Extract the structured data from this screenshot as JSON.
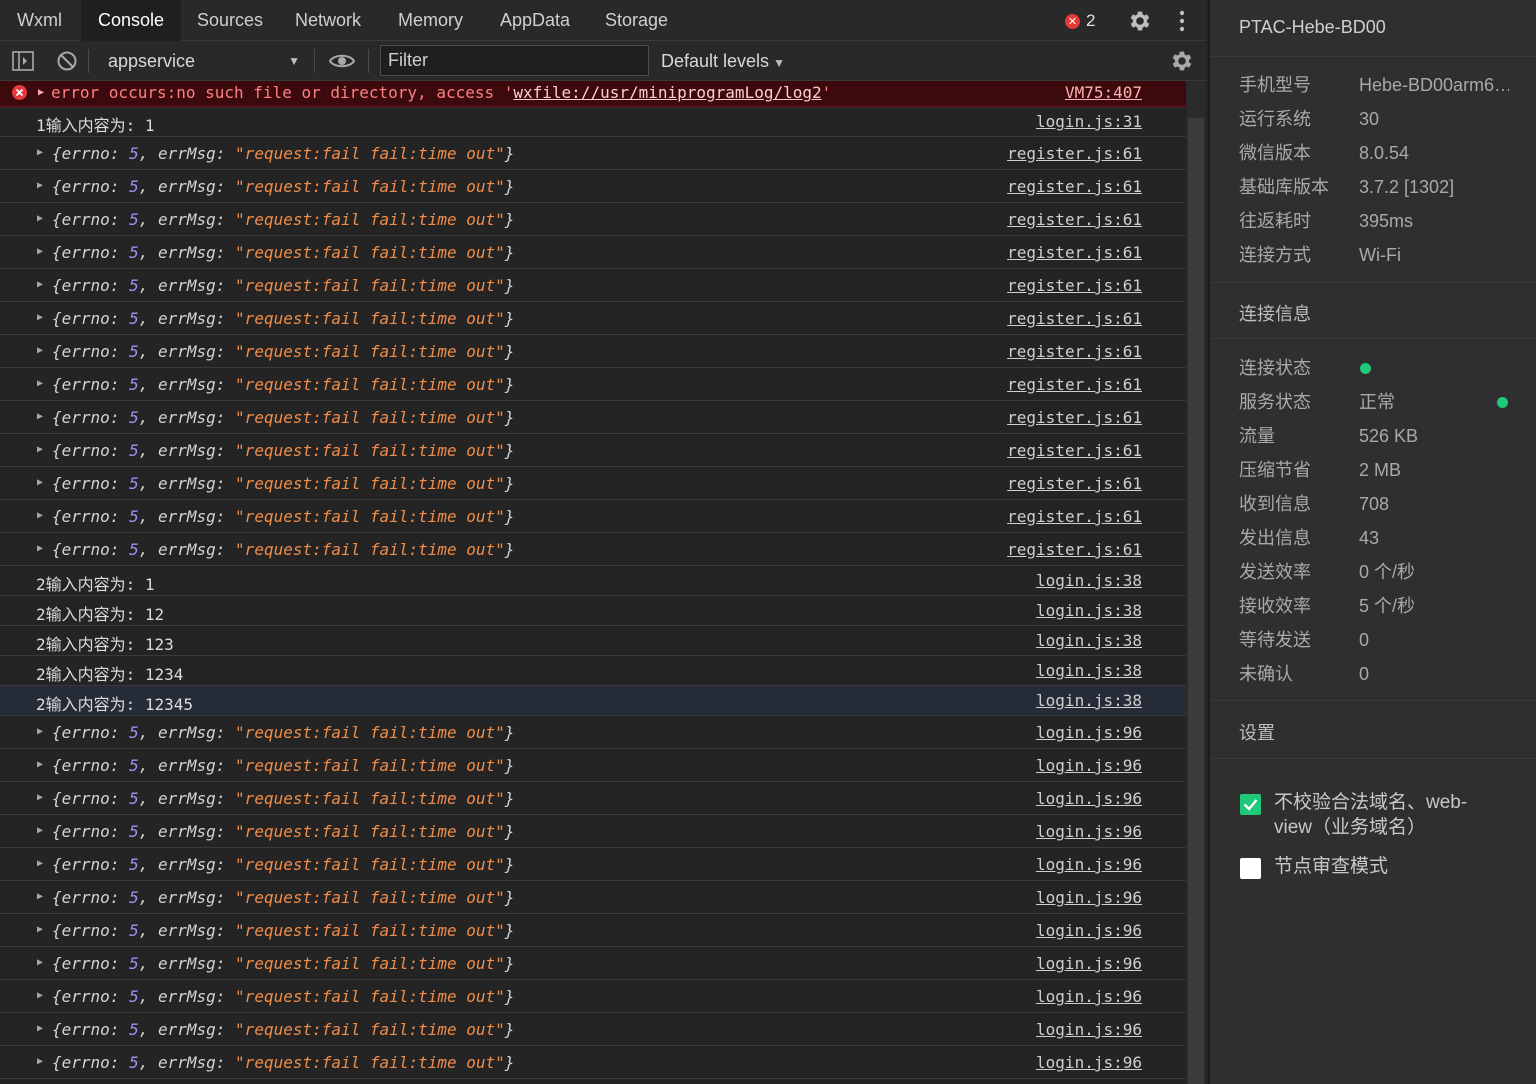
{
  "tabs": [
    {
      "label": "Wxml",
      "active": false
    },
    {
      "label": "Console",
      "active": true
    },
    {
      "label": "Sources",
      "active": false
    },
    {
      "label": "Network",
      "active": false
    },
    {
      "label": "Memory",
      "active": false
    },
    {
      "label": "AppData",
      "active": false
    },
    {
      "label": "Storage",
      "active": false
    }
  ],
  "error_count": "2",
  "toolbar": {
    "context": "appservice",
    "filter_placeholder": "Filter",
    "levels": "Default levels"
  },
  "console": {
    "error": {
      "prefix": "error occurs:no such file or directory, access '",
      "link": "wxfile://usr/miniprogramLog/log2",
      "suffix": "'",
      "source": "VM75:407"
    },
    "rows": [
      {
        "kind": "text",
        "text": "1输入内容为: 1",
        "source": "login.js:31"
      },
      {
        "kind": "obj",
        "errno": "5",
        "errMsg": "\"request:fail fail:time out\"",
        "source": "register.js:61"
      },
      {
        "kind": "obj",
        "errno": "5",
        "errMsg": "\"request:fail fail:time out\"",
        "source": "register.js:61"
      },
      {
        "kind": "obj",
        "errno": "5",
        "errMsg": "\"request:fail fail:time out\"",
        "source": "register.js:61"
      },
      {
        "kind": "obj",
        "errno": "5",
        "errMsg": "\"request:fail fail:time out\"",
        "source": "register.js:61"
      },
      {
        "kind": "obj",
        "errno": "5",
        "errMsg": "\"request:fail fail:time out\"",
        "source": "register.js:61"
      },
      {
        "kind": "obj",
        "errno": "5",
        "errMsg": "\"request:fail fail:time out\"",
        "source": "register.js:61"
      },
      {
        "kind": "obj",
        "errno": "5",
        "errMsg": "\"request:fail fail:time out\"",
        "source": "register.js:61"
      },
      {
        "kind": "obj",
        "errno": "5",
        "errMsg": "\"request:fail fail:time out\"",
        "source": "register.js:61"
      },
      {
        "kind": "obj",
        "errno": "5",
        "errMsg": "\"request:fail fail:time out\"",
        "source": "register.js:61"
      },
      {
        "kind": "obj",
        "errno": "5",
        "errMsg": "\"request:fail fail:time out\"",
        "source": "register.js:61"
      },
      {
        "kind": "obj",
        "errno": "5",
        "errMsg": "\"request:fail fail:time out\"",
        "source": "register.js:61"
      },
      {
        "kind": "obj",
        "errno": "5",
        "errMsg": "\"request:fail fail:time out\"",
        "source": "register.js:61"
      },
      {
        "kind": "obj",
        "errno": "5",
        "errMsg": "\"request:fail fail:time out\"",
        "source": "register.js:61"
      },
      {
        "kind": "text",
        "text": "2输入内容为: 1",
        "source": "login.js:38"
      },
      {
        "kind": "text",
        "text": "2输入内容为: 12",
        "source": "login.js:38"
      },
      {
        "kind": "text",
        "text": "2输入内容为: 123",
        "source": "login.js:38"
      },
      {
        "kind": "text",
        "text": "2输入内容为: 1234",
        "source": "login.js:38"
      },
      {
        "kind": "text",
        "text": "2输入内容为: 12345",
        "source": "login.js:38",
        "highlight": true
      },
      {
        "kind": "obj",
        "errno": "5",
        "errMsg": "\"request:fail fail:time out\"",
        "source": "login.js:96"
      },
      {
        "kind": "obj",
        "errno": "5",
        "errMsg": "\"request:fail fail:time out\"",
        "source": "login.js:96"
      },
      {
        "kind": "obj",
        "errno": "5",
        "errMsg": "\"request:fail fail:time out\"",
        "source": "login.js:96"
      },
      {
        "kind": "obj",
        "errno": "5",
        "errMsg": "\"request:fail fail:time out\"",
        "source": "login.js:96"
      },
      {
        "kind": "obj",
        "errno": "5",
        "errMsg": "\"request:fail fail:time out\"",
        "source": "login.js:96"
      },
      {
        "kind": "obj",
        "errno": "5",
        "errMsg": "\"request:fail fail:time out\"",
        "source": "login.js:96"
      },
      {
        "kind": "obj",
        "errno": "5",
        "errMsg": "\"request:fail fail:time out\"",
        "source": "login.js:96"
      },
      {
        "kind": "obj",
        "errno": "5",
        "errMsg": "\"request:fail fail:time out\"",
        "source": "login.js:96"
      },
      {
        "kind": "obj",
        "errno": "5",
        "errMsg": "\"request:fail fail:time out\"",
        "source": "login.js:96"
      },
      {
        "kind": "obj",
        "errno": "5",
        "errMsg": "\"request:fail fail:time out\"",
        "source": "login.js:96"
      },
      {
        "kind": "obj",
        "errno": "5",
        "errMsg": "\"request:fail fail:time out\"",
        "source": "login.js:96"
      }
    ]
  },
  "device": {
    "name": "PTAC-Hebe-BD00",
    "info": [
      {
        "label": "手机型号",
        "value": "Hebe-BD00arm6…"
      },
      {
        "label": "运行系统",
        "value": "30"
      },
      {
        "label": "微信版本",
        "value": "8.0.54"
      },
      {
        "label": "基础库版本",
        "value": "3.7.2 [1302]"
      },
      {
        "label": "往返耗时",
        "value": "395ms"
      },
      {
        "label": "连接方式",
        "value": "Wi-Fi"
      }
    ],
    "connection_title": "连接信息",
    "connection": [
      {
        "label": "连接状态",
        "value": "",
        "dot": "inline"
      },
      {
        "label": "服务状态",
        "value": "正常",
        "dot": "right"
      },
      {
        "label": "流量",
        "value": "526 KB"
      },
      {
        "label": "压缩节省",
        "value": "2 MB"
      },
      {
        "label": "收到信息",
        "value": "708"
      },
      {
        "label": "发出信息",
        "value": "43"
      },
      {
        "label": "发送效率",
        "value": "0 个/秒"
      },
      {
        "label": "接收效率",
        "value": "5 个/秒"
      },
      {
        "label": "等待发送",
        "value": "0"
      },
      {
        "label": "未确认",
        "value": "0"
      }
    ],
    "settings_title": "设置",
    "settings": [
      {
        "label": "不校验合法域名、web-view（业务域名）",
        "checked": true
      },
      {
        "label": "节点审查模式",
        "checked": false
      }
    ],
    "status_color": "#1ec97a"
  }
}
